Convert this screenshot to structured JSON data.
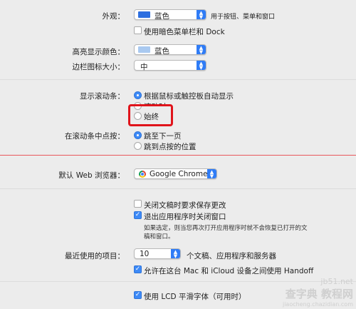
{
  "colors": {
    "accent": "#2f7cf6",
    "highlight_red": "#e0141b",
    "separator_red": "#e8585d",
    "swatch_blue": "#2d6fe0",
    "swatch_light_blue": "#a9c9f0"
  },
  "appearance": {
    "label": "外观：",
    "value": "蓝色",
    "note": "用于按钮、菜单和窗口"
  },
  "dark_menu": {
    "label": "使用暗色菜单栏和 Dock",
    "checked": false
  },
  "highlight_color": {
    "label": "高亮显示颜色：",
    "value": "蓝色"
  },
  "sidebar_icon_size": {
    "label": "边栏图标大小：",
    "value": "中"
  },
  "scrollbars": {
    "label": "显示滚动条：",
    "options": [
      {
        "label": "根据鼠标或触控板自动显示",
        "selected": true
      },
      {
        "label": "滚动时",
        "selected": false
      },
      {
        "label": "始终",
        "selected": false
      }
    ]
  },
  "scroll_click": {
    "label": "在滚动条中点按：",
    "options": [
      {
        "label": "跳至下一页",
        "selected": true
      },
      {
        "label": "跳到点按的位置",
        "selected": false
      }
    ]
  },
  "default_browser": {
    "label": "默认 Web 浏览器：",
    "value": "Google Chrome",
    "icon": "chrome-icon"
  },
  "ask_save": {
    "label": "关闭文稿时要求保存更改",
    "checked": false
  },
  "close_windows": {
    "label": "退出应用程序时关闭窗口",
    "checked": true,
    "desc_line1": "如果选定，则当您再次打开应用程序时就不会恢复已打开的文",
    "desc_line2": "稿和窗口。"
  },
  "recent_items": {
    "label": "最近使用的项目：",
    "value": "10",
    "suffix": "个文稿、应用程序和服务器"
  },
  "handoff": {
    "label": "允许在这台 Mac 和 iCloud 设备之间使用 Handoff",
    "checked": true
  },
  "lcd_smoothing": {
    "label": "使用 LCD 平滑字体（可用时）",
    "checked": true
  },
  "watermark": {
    "line1": "查字典 教程网",
    "line2": "jiaocheng.chazidian.com",
    "line3": "jb51.net"
  }
}
